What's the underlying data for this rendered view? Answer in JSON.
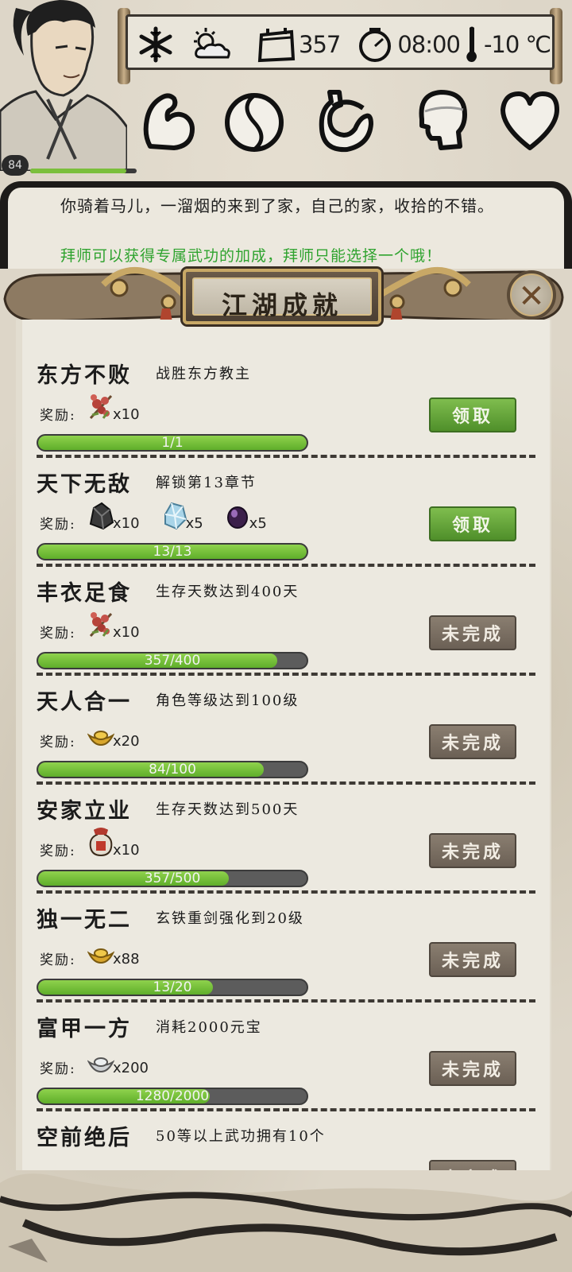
{
  "status": {
    "level": "84",
    "level_progress": 0.9,
    "days": "357",
    "time": "08:00",
    "temperature": "-10 ℃",
    "icons": [
      "snowflake-icon",
      "sun-cloud-icon",
      "calendar-icon",
      "clock-icon",
      "thermometer-icon"
    ]
  },
  "attributes": [
    "strength-icon",
    "yin-yang-icon",
    "stomach-icon",
    "mind-icon",
    "heart-icon"
  ],
  "story": {
    "text": "你骑着马儿，一溜烟的来到了家，自己的家，收拾的不错。",
    "hint": "拜师可以获得专属武功的加成，拜师只能选择一个哦！"
  },
  "dialog": {
    "title": "江湖成就",
    "close_icon": "close-icon",
    "reward_label": "奖励:",
    "achievements": [
      {
        "name": "东方不败",
        "desc": "战胜东方教主",
        "rewards": [
          {
            "icon": "flower-icon",
            "qty": "x10"
          }
        ],
        "progress": "1/1",
        "ratio": 1.0,
        "button": "领取",
        "status": "claim"
      },
      {
        "name": "天下无敌",
        "desc": "解锁第13章节",
        "rewards": [
          {
            "icon": "ore-icon",
            "qty": "x10"
          },
          {
            "icon": "crystal-icon",
            "qty": "x5"
          },
          {
            "icon": "gem-icon",
            "qty": "x5"
          }
        ],
        "progress": "13/13",
        "ratio": 1.0,
        "button": "领取",
        "status": "claim"
      },
      {
        "name": "丰衣足食",
        "desc": "生存天数达到400天",
        "rewards": [
          {
            "icon": "flower-icon",
            "qty": "x10"
          }
        ],
        "progress": "357/400",
        "ratio": 0.8925,
        "button": "未完成",
        "status": "pending"
      },
      {
        "name": "天人合一",
        "desc": "角色等级达到100级",
        "rewards": [
          {
            "icon": "gold-ingot-icon",
            "qty": "x20"
          }
        ],
        "progress": "84/100",
        "ratio": 0.84,
        "button": "未完成",
        "status": "pending"
      },
      {
        "name": "安家立业",
        "desc": "生存天数达到500天",
        "rewards": [
          {
            "icon": "wine-jar-icon",
            "qty": "x10"
          }
        ],
        "progress": "357/500",
        "ratio": 0.714,
        "button": "未完成",
        "status": "pending"
      },
      {
        "name": "独一无二",
        "desc": "玄铁重剑强化到20级",
        "rewards": [
          {
            "icon": "gold-ingot-icon",
            "qty": "x88"
          }
        ],
        "progress": "13/20",
        "ratio": 0.65,
        "button": "未完成",
        "status": "pending"
      },
      {
        "name": "富甲一方",
        "desc": "消耗2000元宝",
        "rewards": [
          {
            "icon": "silver-ingot-icon",
            "qty": "x200"
          }
        ],
        "progress": "1280/2000",
        "ratio": 0.64,
        "button": "未完成",
        "status": "pending"
      },
      {
        "name": "空前绝后",
        "desc": "50等以上武功拥有10个",
        "rewards": [],
        "progress": "",
        "ratio": 0,
        "button": "未完成",
        "status": "pending"
      }
    ]
  },
  "colors": {
    "claim": "#5f9e33",
    "pending": "#7a6f63",
    "progress": "#6fbe36",
    "hint": "#2fa32f"
  }
}
